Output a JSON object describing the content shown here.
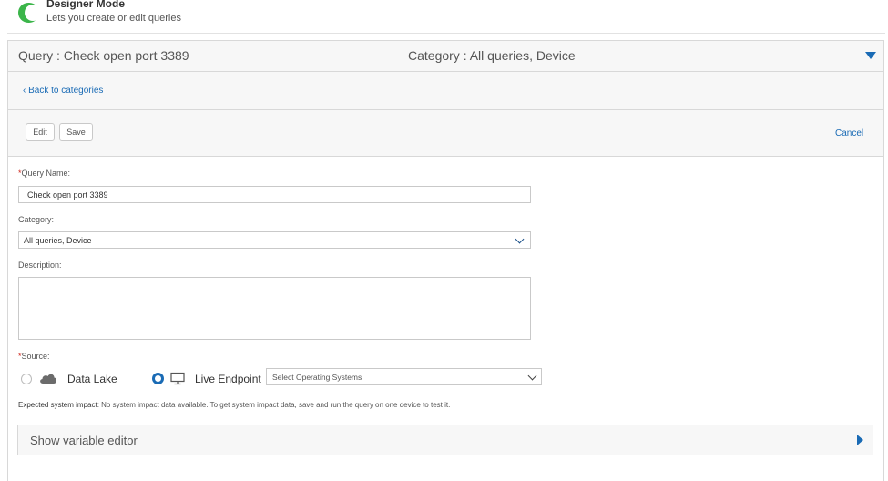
{
  "designer_mode": {
    "title": "Designer Mode",
    "subtitle": "Lets you create or edit queries",
    "enabled": true,
    "toggle_color": "#3bb54a"
  },
  "query_header": {
    "title": "Query : Check open port 3389",
    "category": "Category : All queries, Device",
    "accent_color": "#1a6bb5"
  },
  "back_link": "‹ Back to categories",
  "toolbar": {
    "edit_label": "Edit",
    "save_label": "Save",
    "cancel_label": "Cancel"
  },
  "form": {
    "query_name_label": "Query Name:",
    "query_name_value": "Check open port 3389",
    "category_label": "Category:",
    "category_value": "All queries, Device",
    "description_label": "Description:",
    "description_value": "",
    "source_label": "Source:",
    "required_mark": "*",
    "sources": [
      {
        "label": "Data Lake",
        "icon": "cloud-icon",
        "selected": false
      },
      {
        "label": "Live Endpoint",
        "icon": "monitor-icon",
        "selected": true
      }
    ],
    "os_select_placeholder": "Select Operating Systems"
  },
  "impact": {
    "label": "Expected system impact:",
    "text": " No system impact data available. To get system impact data, save and run the query on one device to test it."
  },
  "variable_editor": {
    "label": "Show variable editor"
  }
}
